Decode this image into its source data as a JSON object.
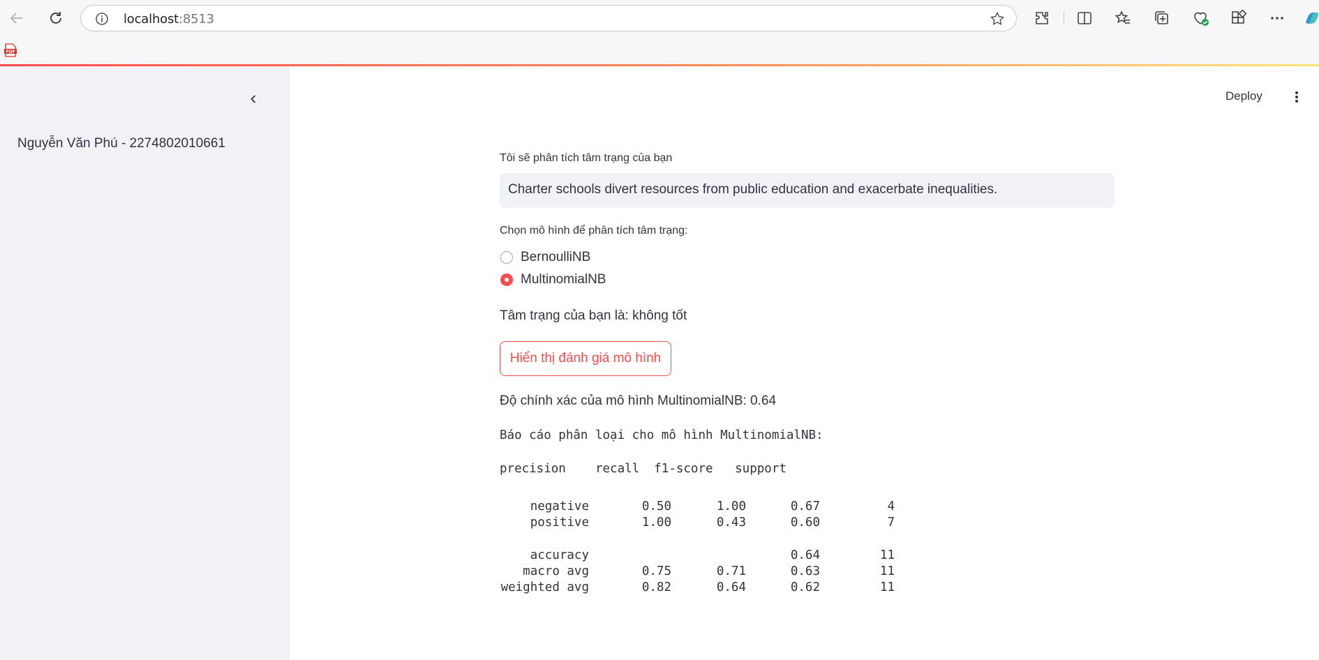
{
  "browser": {
    "url_host": "localhost",
    "url_port": ":8513"
  },
  "sidebar": {
    "author": "Nguyễn Văn Phú - 2274802010661"
  },
  "header": {
    "deploy_label": "Deploy"
  },
  "main": {
    "input_label": "Tôi sẽ phân tích tâm trạng của bạn",
    "input_value": "Charter schools divert resources from public education and exacerbate inequalities.",
    "radio_label": "Chọn mô hình để phân tích tâm trạng:",
    "radio_options": [
      "BernoulliNB",
      "MultinomialNB"
    ],
    "radio_selected": "MultinomialNB",
    "result_text": "Tâm trạng của bạn là: không tốt",
    "eval_button_label": "Hiển thị đánh giá mô hình",
    "accuracy_text": "Độ chính xác của mô hình MultinomialNB: 0.64",
    "report_title": "Báo cáo phân loại cho mô hình MultinomialNB:",
    "report_header": "precision    recall  f1-score   support",
    "report_rows": [
      {
        "label": "negative",
        "precision": "0.50",
        "recall": "1.00",
        "f1": "0.67",
        "support": "4"
      },
      {
        "label": "positive",
        "precision": "1.00",
        "recall": "0.43",
        "f1": "0.60",
        "support": "7"
      },
      {
        "label": "accuracy",
        "precision": "",
        "recall": "",
        "f1": "0.64",
        "support": "11"
      },
      {
        "label": "macro avg",
        "precision": "0.75",
        "recall": "0.71",
        "f1": "0.63",
        "support": "11"
      },
      {
        "label": "weighted avg",
        "precision": "0.82",
        "recall": "0.64",
        "f1": "0.62",
        "support": "11"
      }
    ]
  },
  "colors": {
    "accent": "#ff4b4b",
    "sidebar_bg": "#f0f2f6",
    "text": "#31333f"
  }
}
